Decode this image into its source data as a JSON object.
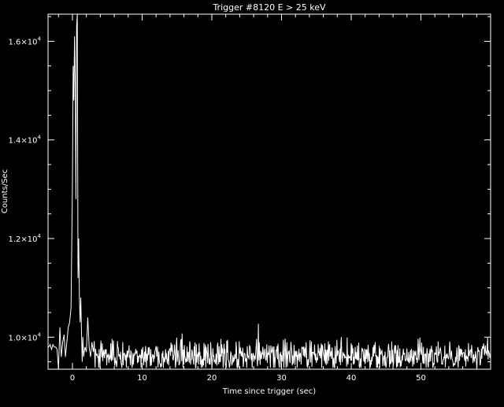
{
  "chart_data": {
    "type": "line",
    "title": "Trigger #8120 E > 25 keV",
    "xlabel": "Time since trigger (sec)",
    "ylabel": "Counts/Sec",
    "xlim": [
      -3.5,
      60
    ],
    "ylim": [
      9350,
      16550
    ],
    "grid": false,
    "x_ticks": [
      {
        "value": 0,
        "label": "0"
      },
      {
        "value": 10,
        "label": "10"
      },
      {
        "value": 20,
        "label": "20"
      },
      {
        "value": 30,
        "label": "30"
      },
      {
        "value": 40,
        "label": "40"
      },
      {
        "value": 50,
        "label": "50"
      }
    ],
    "y_ticks": [
      {
        "value": 10000,
        "mantissa": "1.0",
        "base": "10",
        "exponent": "4"
      },
      {
        "value": 12000,
        "mantissa": "1.2",
        "base": "10",
        "exponent": "4"
      },
      {
        "value": 14000,
        "mantissa": "1.4",
        "base": "10",
        "exponent": "4"
      },
      {
        "value": 16000,
        "mantissa": "1.6",
        "base": "10",
        "exponent": "4"
      }
    ],
    "series": [
      {
        "x": [
          -3.5,
          -3.4,
          -3.2,
          -3,
          -2.8,
          -2.6,
          -2.4,
          -2.2,
          -2,
          -1.8,
          -1.6,
          -1.4,
          -1.2,
          -1,
          -0.8,
          -0.6,
          -0.4,
          -0.2,
          0,
          0.1,
          0.2,
          0.3,
          0.4,
          0.5,
          0.6,
          0.7,
          0.8,
          0.9,
          1,
          1.1,
          1.2,
          1.3,
          1.4,
          1.5,
          1.6,
          1.8,
          2,
          2.2,
          2.4,
          2.6,
          2.8,
          3
        ],
        "y": [
          9800,
          9800,
          9850,
          9750,
          9850,
          9800,
          9800,
          9750,
          9300,
          10200,
          9600,
          9900,
          10050,
          9600,
          9900,
          10200,
          10300,
          10600,
          13100,
          15500,
          14800,
          16100,
          15200,
          12800,
          16300,
          16550,
          11200,
          12000,
          10800,
          10300,
          10800,
          10100,
          9500,
          10000,
          9600,
          9800,
          9700,
          10400,
          9800,
          9600,
          9900,
          9700
        ]
      }
    ]
  }
}
